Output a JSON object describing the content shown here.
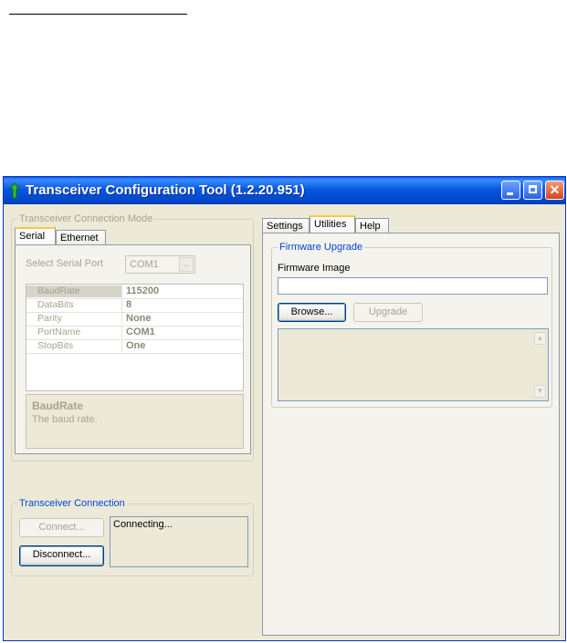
{
  "window": {
    "title": "Transceiver Configuration Tool (1.2.20.951)"
  },
  "connection_mode": {
    "legend": "Transceiver Connection Mode",
    "tabs": [
      {
        "label": "Serial",
        "active": true
      },
      {
        "label": "Ethernet",
        "active": false
      }
    ],
    "select_port_label": "Select Serial Port",
    "select_port_value": "COM1",
    "properties": [
      {
        "name": "BaudRate",
        "value": "115200"
      },
      {
        "name": "DataBits",
        "value": "8"
      },
      {
        "name": "Parity",
        "value": "None"
      },
      {
        "name": "PortName",
        "value": "COM1"
      },
      {
        "name": "StopBits",
        "value": "One"
      }
    ],
    "help_title": "BaudRate",
    "help_text": "The baud rate."
  },
  "connection": {
    "legend": "Transceiver Connection",
    "connect_label": "Connect...",
    "disconnect_label": "Disconnect...",
    "status_text": "Connecting..."
  },
  "right_tabs": [
    {
      "label": "Settings",
      "active": false
    },
    {
      "label": "Utilities",
      "active": true
    },
    {
      "label": "Help",
      "active": false
    }
  ],
  "firmware": {
    "legend": "Firmware Upgrade",
    "image_label": "Firmware Image",
    "image_value": "",
    "browse_label": "Browse...",
    "upgrade_label": "Upgrade"
  },
  "colors": {
    "titlebar": "#0058e6",
    "window_bg": "#ece9d8",
    "group_legend_blue": "#0046d5",
    "disabled_text": "#a4a48f"
  }
}
